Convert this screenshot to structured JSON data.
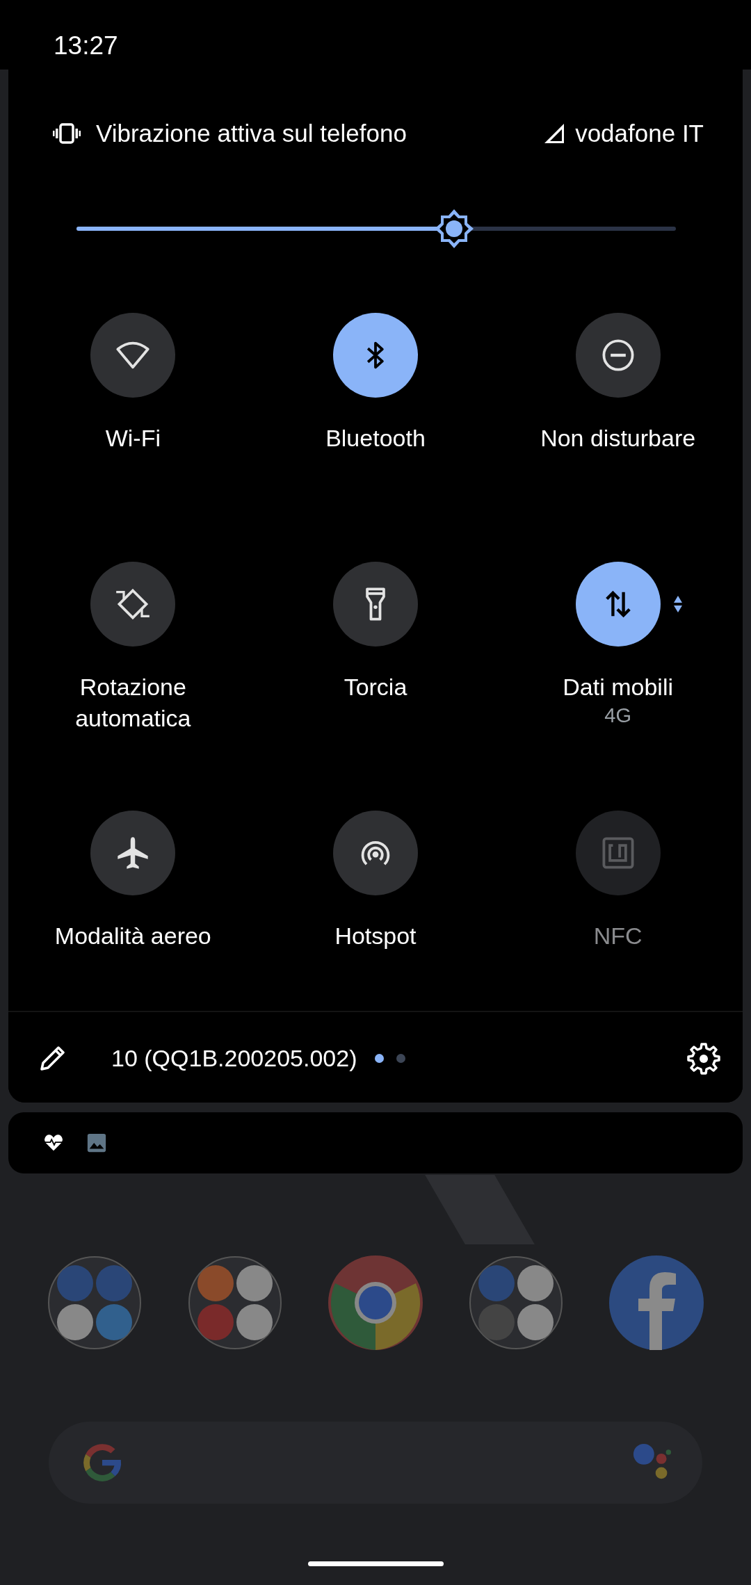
{
  "status_bar": {
    "time": "13:27"
  },
  "header": {
    "ringer": "Vibrazione attiva sul telefono",
    "carrier": "vodafone IT"
  },
  "brightness": {
    "level": 0.63
  },
  "tiles": [
    {
      "kind": "wifi",
      "label": "Wi-Fi",
      "on": false,
      "disabled": false
    },
    {
      "kind": "bluetooth",
      "label": "Bluetooth",
      "on": true,
      "disabled": false
    },
    {
      "kind": "dnd",
      "label": "Non disturbare",
      "on": false,
      "disabled": false
    },
    {
      "kind": "rotate",
      "label": "Rotazione automatica",
      "on": false,
      "disabled": false
    },
    {
      "kind": "torch",
      "label": "Torcia",
      "on": false,
      "disabled": false
    },
    {
      "kind": "data",
      "label": "Dati mobili",
      "secondary": "4G",
      "on": true,
      "disabled": false
    },
    {
      "kind": "airplane",
      "label": "Modalità aereo",
      "on": false,
      "disabled": false
    },
    {
      "kind": "hotspot",
      "label": "Hotspot",
      "on": false,
      "disabled": false
    },
    {
      "kind": "nfc",
      "label": "NFC",
      "on": false,
      "disabled": true
    }
  ],
  "footer": {
    "build": "10 (QQ1B.200205.002)",
    "pages": [
      {
        "selected": true
      },
      {
        "selected": false
      }
    ]
  }
}
